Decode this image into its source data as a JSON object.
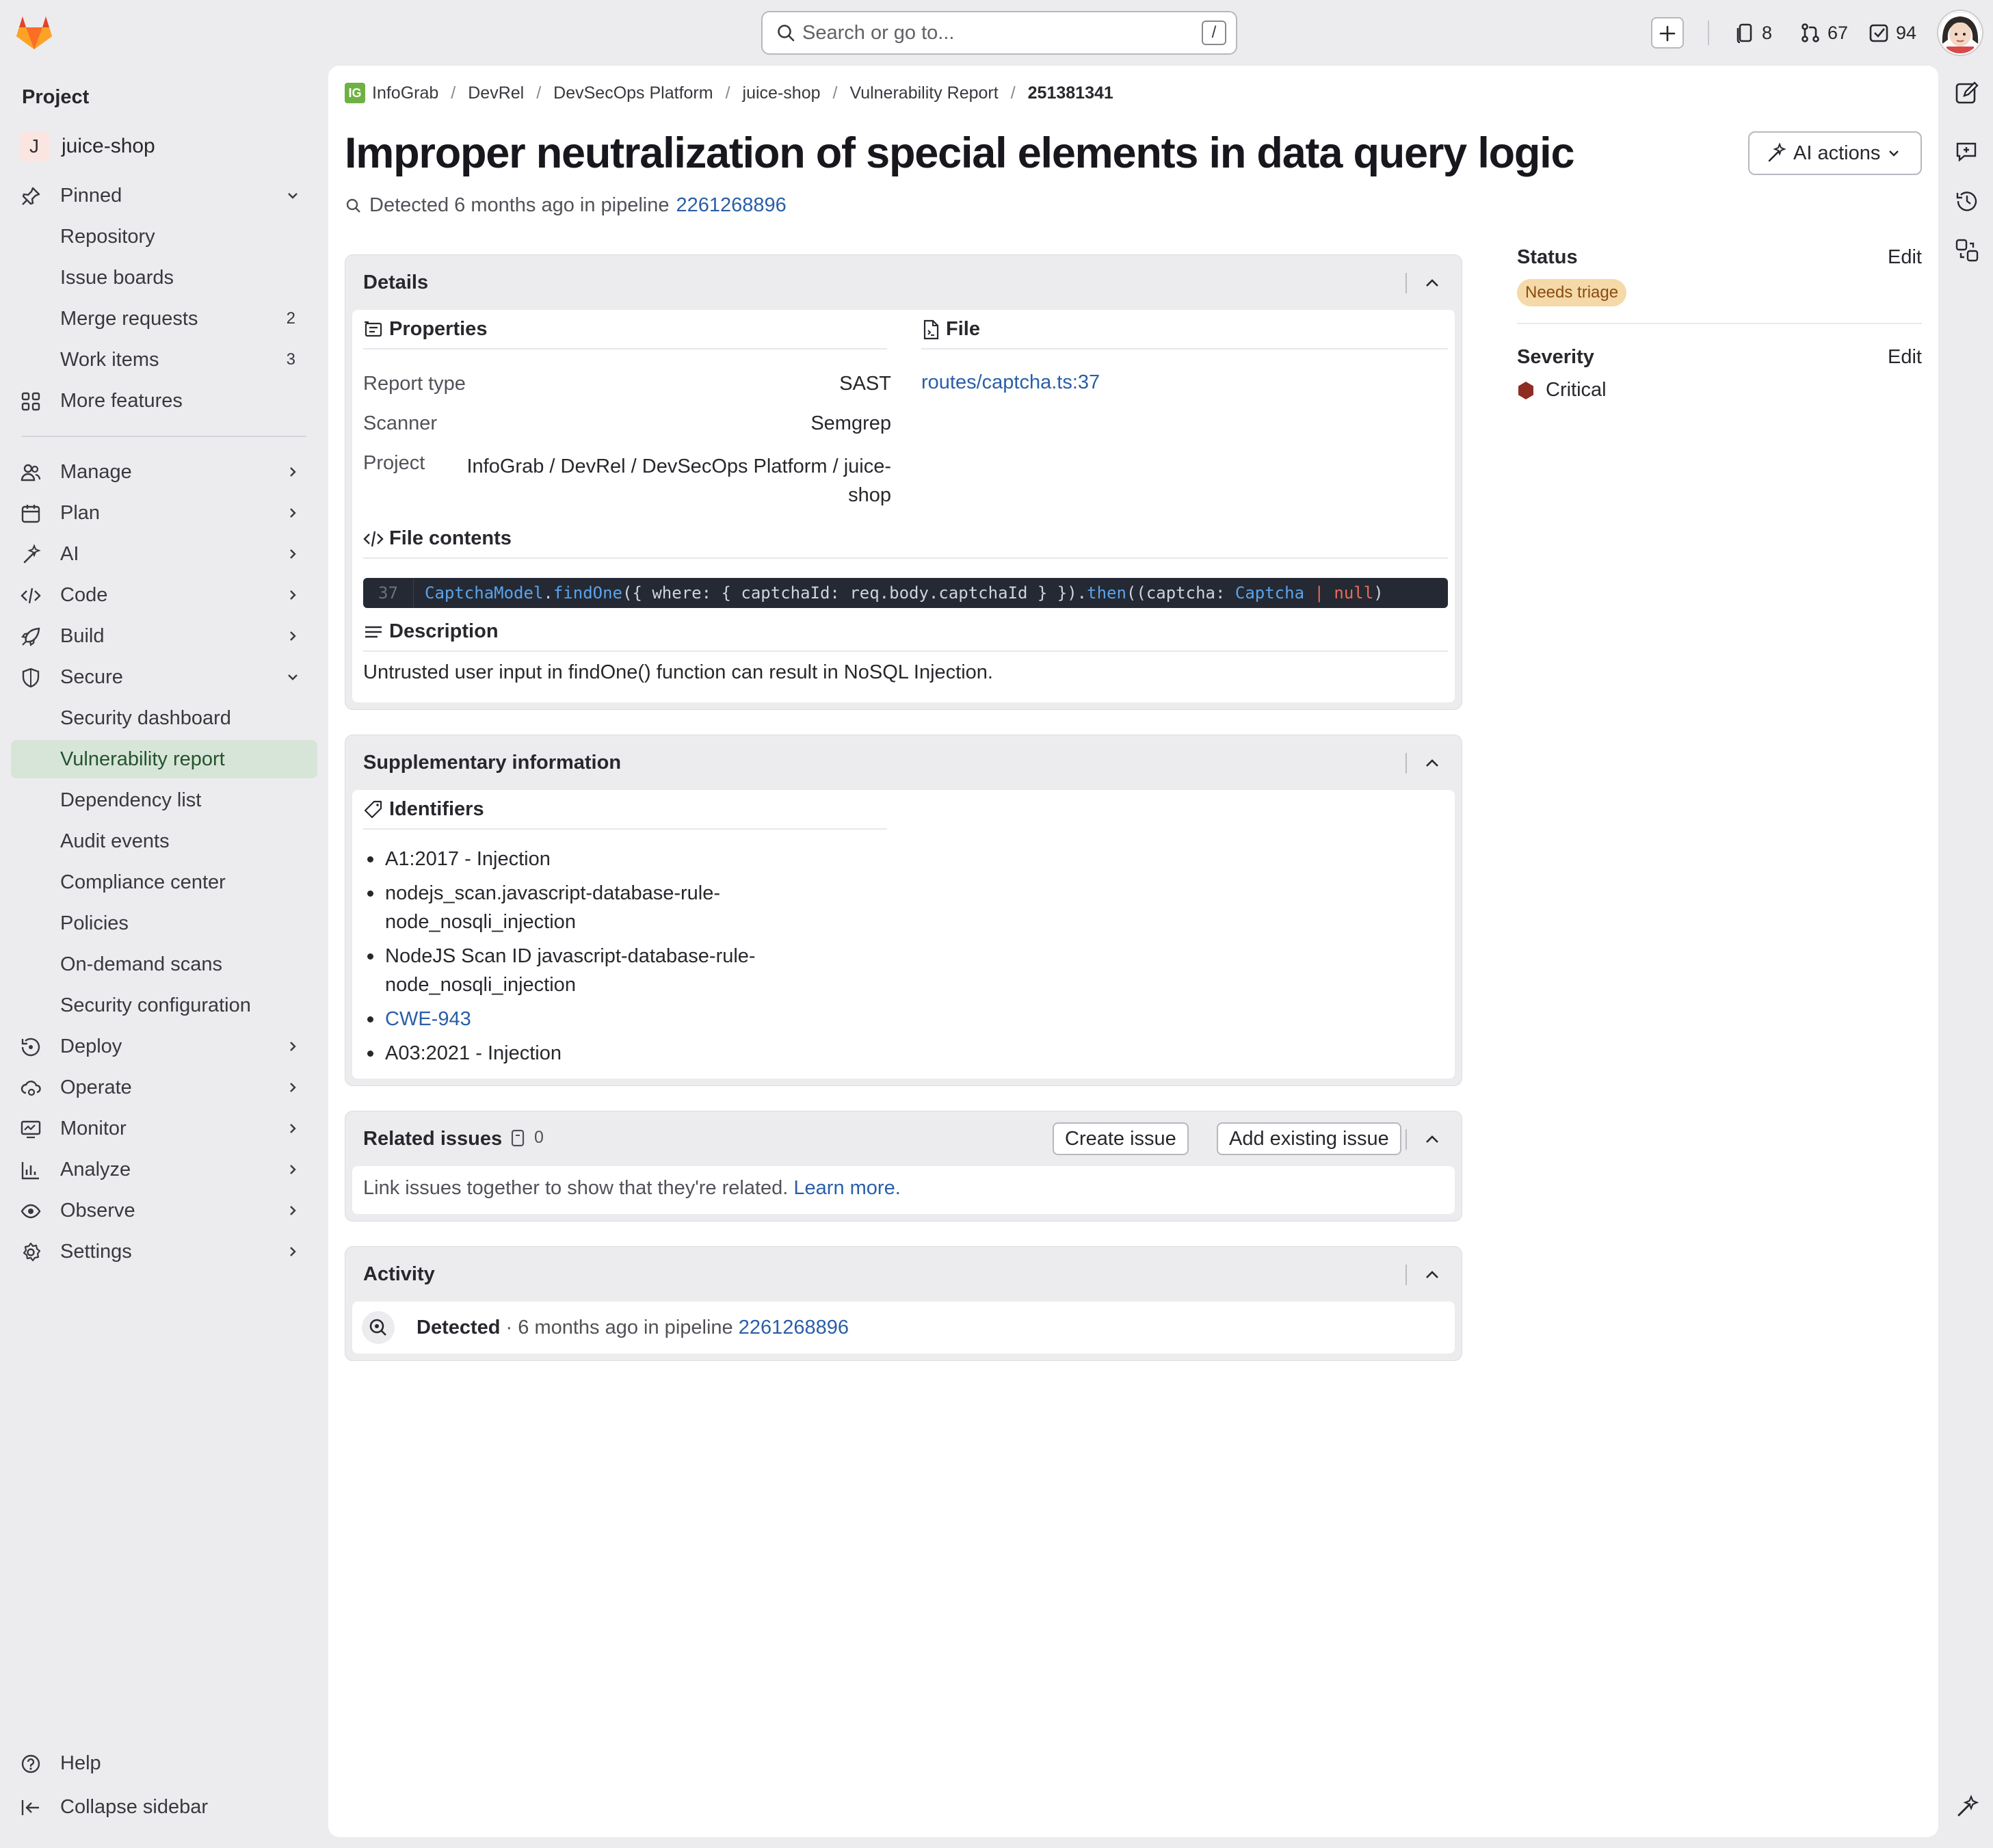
{
  "topbar": {
    "search_placeholder": "Search or go to...",
    "search_shortcut": "/",
    "issues_count": "8",
    "merge_requests_count": "67",
    "todos_count": "94"
  },
  "sidebar": {
    "heading": "Project",
    "project_initial": "J",
    "project_name": "juice-shop",
    "pinned": {
      "label": "Pinned",
      "items": [
        {
          "label": "Repository",
          "count": ""
        },
        {
          "label": "Issue boards",
          "count": ""
        },
        {
          "label": "Merge requests",
          "count": "2"
        },
        {
          "label": "Work items",
          "count": "3"
        }
      ]
    },
    "more_features": "More features",
    "nav": [
      {
        "label": "Manage",
        "icon": "users-icon"
      },
      {
        "label": "Plan",
        "icon": "calendar-icon"
      },
      {
        "label": "AI",
        "icon": "sparkle-icon"
      },
      {
        "label": "Code",
        "icon": "code-icon"
      },
      {
        "label": "Build",
        "icon": "rocket-icon"
      },
      {
        "label": "Secure",
        "icon": "shield-icon"
      }
    ],
    "secure_items": [
      "Security dashboard",
      "Vulnerability report",
      "Dependency list",
      "Audit events",
      "Compliance center",
      "Policies",
      "On-demand scans",
      "Security configuration"
    ],
    "nav2": [
      {
        "label": "Deploy",
        "icon": "deploy-icon"
      },
      {
        "label": "Operate",
        "icon": "cloud-gear-icon"
      },
      {
        "label": "Monitor",
        "icon": "monitor-icon"
      },
      {
        "label": "Analyze",
        "icon": "chart-icon"
      },
      {
        "label": "Observe",
        "icon": "eye-icon"
      },
      {
        "label": "Settings",
        "icon": "gear-icon"
      }
    ],
    "help": "Help",
    "collapse": "Collapse sidebar"
  },
  "breadcrumb": [
    "InfoGrab",
    "DevRel",
    "DevSecOps Platform",
    "juice-shop",
    "Vulnerability Report",
    "251381341"
  ],
  "breadcrumb_icon_text": "IG",
  "page": {
    "title": "Improper neutralization of special elements in data query logic",
    "ai_actions": "AI actions",
    "detected_prefix": "Detected 6 months ago in pipeline",
    "pipeline_id": "2261268896"
  },
  "details": {
    "title": "Details",
    "properties_heading": "Properties",
    "report_type_label": "Report type",
    "report_type": "SAST",
    "scanner_label": "Scanner",
    "scanner": "Semgrep",
    "project_label": "Project",
    "project_line1": "InfoGrab / DevRel / DevSecOps Platform / juice-",
    "project_line2": "shop",
    "file_heading": "File",
    "file_link": "routes/captcha.ts:37",
    "file_contents_heading": "File contents",
    "code_line_number": "37",
    "code": {
      "t1": "CaptchaModel",
      "t2": ".",
      "t3": "findOne",
      "t4": "({ where: { captchaId: req.body.captchaId } }).",
      "t5": "then",
      "t6": "((captcha: ",
      "t7": "Captcha",
      "t8": " | ",
      "t9": "null",
      "t10": ")"
    },
    "description_heading": "Description",
    "description": "Untrusted user input in findOne() function can result in NoSQL Injection."
  },
  "supplementary": {
    "title": "Supplementary information",
    "identifiers_heading": "Identifiers",
    "identifiers": [
      "A1:2017 - Injection",
      "nodejs_scan.javascript-database-rule-node_nosqli_injection",
      "NodeJS Scan ID javascript-database-rule-node_nosqli_injection",
      "CWE-943",
      "A03:2021 - Injection"
    ]
  },
  "related": {
    "title": "Related issues",
    "count": "0",
    "create_issue": "Create issue",
    "add_existing": "Add existing issue",
    "body": "Link issues together to show that they're related.",
    "learn_more": "Learn more."
  },
  "activity": {
    "title": "Activity",
    "event": "Detected",
    "middle": " · 6 months ago in pipeline ",
    "pipeline_id": "2261268896"
  },
  "right_panel": {
    "status_label": "Status",
    "status_value": "Needs triage",
    "severity_label": "Severity",
    "severity_value": "Critical",
    "edit": "Edit"
  },
  "colors": {
    "accent": "#1f75cb",
    "active_nav_bg": "#d7e5d8",
    "status_badge_bg": "#f5d9a8",
    "critical": "#8d2d23"
  }
}
